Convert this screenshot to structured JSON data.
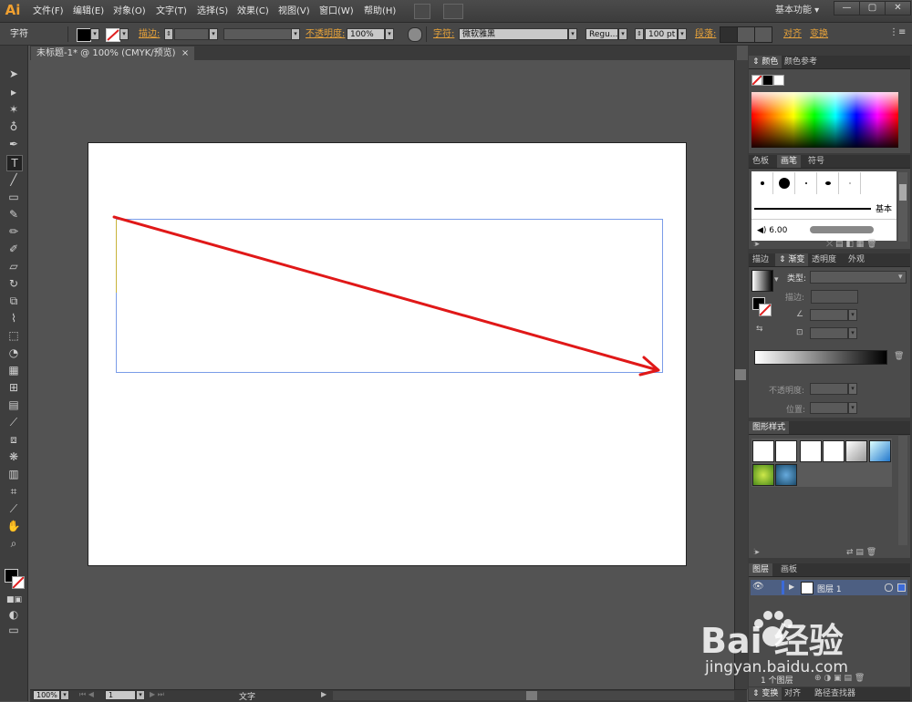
{
  "app": {
    "logo": "Ai",
    "workspace": "基本功能"
  },
  "menu": [
    "文件(F)",
    "编辑(E)",
    "对象(O)",
    "文字(T)",
    "选择(S)",
    "效果(C)",
    "视图(V)",
    "窗口(W)",
    "帮助(H)"
  ],
  "window_controls": {
    "minimize": "—",
    "restore": "▢",
    "close": "✕"
  },
  "control_bar": {
    "mode_label": "字符",
    "stroke_label": "描边:",
    "opacity_label": "不透明度:",
    "opacity_value": "100%",
    "font_label": "字符:",
    "font_value": "微软雅黑",
    "font_style": "Regu...",
    "font_size": "100 pt",
    "paragraph_label": "段落:",
    "align_label": "对齐",
    "transform_label": "变换"
  },
  "document_tab": {
    "title": "未标题-1* @ 100% (CMYK/预览)",
    "close": "×"
  },
  "status_bar": {
    "zoom": "100%",
    "artboard": "1",
    "tool": "文字"
  },
  "panels": {
    "color": {
      "tabs": [
        "颜色",
        "颜色参考"
      ]
    },
    "brushes": {
      "tabs": [
        "色板",
        "画笔",
        "符号"
      ],
      "basic_label": "基本",
      "size_value": "6.00"
    },
    "gradient": {
      "tabs": [
        "描边",
        "渐变",
        "透明度",
        "外观"
      ],
      "type_label": "类型:",
      "stroke_label": "描边:",
      "opacity_label": "不透明度:",
      "position_label": "位置:"
    },
    "graphic_styles": {
      "tabs": [
        "图形样式"
      ]
    },
    "layers": {
      "tabs": [
        "图层",
        "画板"
      ],
      "layer_name": "图层 1",
      "count_label": "1 个图层"
    },
    "bottom": {
      "tabs": [
        "变换",
        "对齐",
        "路径查找器"
      ]
    }
  },
  "watermark": {
    "brand": "Bai  经验",
    "url": "jingyan.baidu.com"
  },
  "colors": {
    "accent_orange": "#e8a33a",
    "frame_blue": "#7a9ce8",
    "arrow_red": "#e01818"
  }
}
